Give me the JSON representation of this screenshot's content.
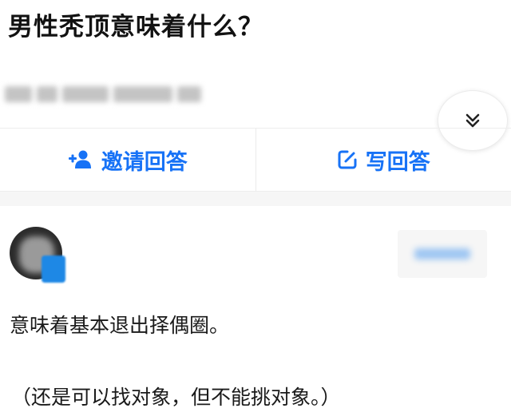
{
  "question": {
    "title": "男性秃顶意味着什么？"
  },
  "actions": {
    "invite_label": "邀请回答",
    "write_label": "写回答"
  },
  "answer": {
    "lines": [
      "意味着基本退出择偶圈。",
      "（还是可以找对象，但不能挑对象。）"
    ]
  },
  "icons": {
    "expand": "double-chevron-down-icon",
    "invite": "add-user-icon",
    "write": "edit-icon"
  },
  "colors": {
    "accent": "#1772f6",
    "text": "#1a1a1a"
  }
}
